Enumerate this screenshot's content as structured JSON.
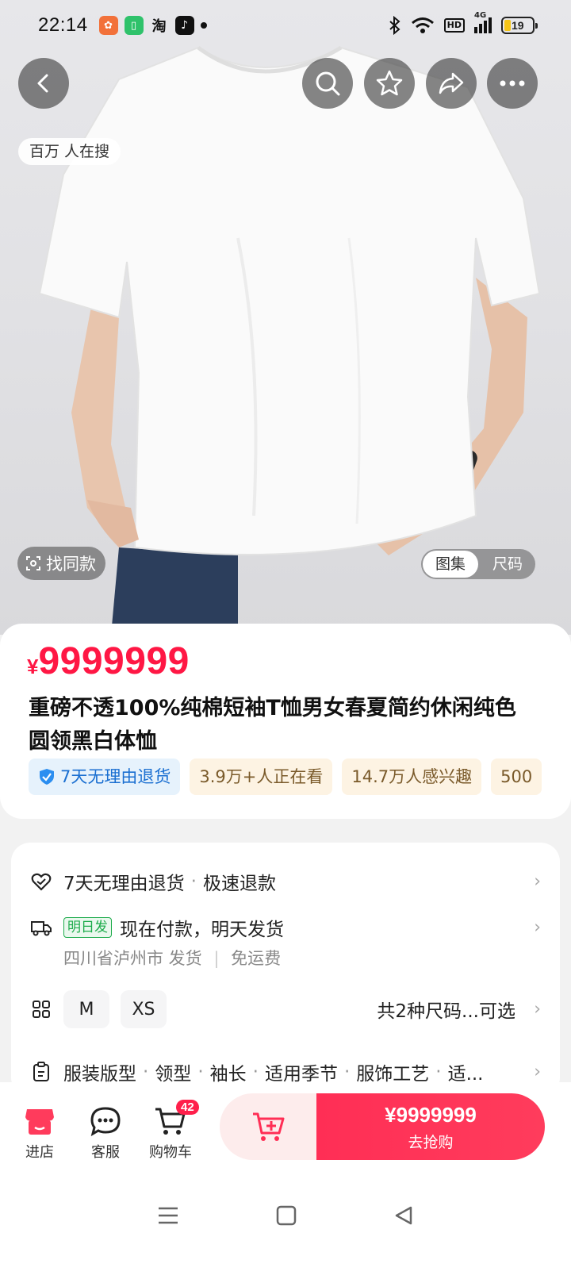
{
  "status_bar": {
    "time": "22:14",
    "app_icons": [
      "pinduoduo-icon",
      "phone-manager-icon",
      "taobao-icon",
      "tiktok-icon"
    ],
    "taobao_label": "淘",
    "hd_label": "HD",
    "network_label": "4G",
    "battery_percent": "19"
  },
  "header": {
    "search_badge": "百万 人在搜"
  },
  "image_controls": {
    "find_same_label": "找同款",
    "tabs": [
      {
        "label": "图集",
        "active": true
      },
      {
        "label": "尺码",
        "active": false
      }
    ]
  },
  "product": {
    "currency": "¥",
    "price": "9999999",
    "title": "重磅不透100%纯棉短袖T恤男女春夏简约休闲纯色圆领黑白体恤",
    "tags": [
      {
        "label": "7天无理由退货",
        "style": "blue"
      },
      {
        "label": "3.9万+人正在看",
        "style": "tan"
      },
      {
        "label": "14.7万人感兴趣",
        "style": "tan"
      },
      {
        "label": "500",
        "style": "tan"
      }
    ]
  },
  "service": {
    "returns_main": "7天无理由退货",
    "returns_extra": "极速退款",
    "shipping_tag": "明日发",
    "shipping_text": "现在付款，明天发货",
    "shipping_origin": "四川省泸州市 发货",
    "shipping_fee": "免运费",
    "sizes": [
      "M",
      "XS"
    ],
    "sizes_summary": "共2种尺码...可选",
    "attributes": [
      "服装版型",
      "领型",
      "袖长",
      "适用季节",
      "服饰工艺",
      "适..."
    ]
  },
  "bottom_bar": {
    "store_label": "进店",
    "service_label": "客服",
    "cart_label": "购物车",
    "cart_count": "42",
    "buy_price": "¥9999999",
    "buy_label": "去抢购"
  },
  "colors": {
    "accent": "#ff1744",
    "buy_button": "#ff2e55",
    "store_icon": "#ff3b5c"
  }
}
